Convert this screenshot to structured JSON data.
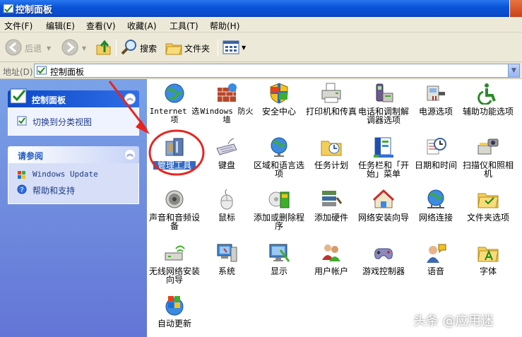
{
  "window": {
    "title": "控制面板"
  },
  "menu": [
    "文件(F)",
    "编辑(E)",
    "查看(V)",
    "收藏(A)",
    "工具(T)",
    "帮助(H)"
  ],
  "toolbar": {
    "back": "后退",
    "search": "搜索",
    "folders": "文件夹"
  },
  "address": {
    "label": "地址(D)",
    "value": "控制面板"
  },
  "left": {
    "panel1": {
      "title": "控制面板",
      "link": "切换到分类视图"
    },
    "panel2": {
      "title": "请参阅",
      "links": [
        "Windows Update",
        "帮助和支持"
      ]
    }
  },
  "items": [
    {
      "name": "Internet 选项",
      "icon": "globe-icon"
    },
    {
      "name": "Windows 防火墙",
      "icon": "firewall-icon"
    },
    {
      "name": "安全中心",
      "icon": "shield-icon"
    },
    {
      "name": "打印机和传真",
      "icon": "printer-icon"
    },
    {
      "name": "电话和调制解调器选项",
      "icon": "phone-icon"
    },
    {
      "name": "电源选项",
      "icon": "power-icon"
    },
    {
      "name": "辅助功能选项",
      "icon": "accessibility-icon"
    },
    {
      "name": "管理工具",
      "icon": "admin-tools-icon",
      "selected": true
    },
    {
      "name": "键盘",
      "icon": "keyboard-icon"
    },
    {
      "name": "区域和语言选项",
      "icon": "region-globe-icon"
    },
    {
      "name": "任务计划",
      "icon": "scheduled-folder-icon"
    },
    {
      "name": "任务栏和「开始」菜单",
      "icon": "taskbar-icon"
    },
    {
      "name": "日期和时间",
      "icon": "clock-icon"
    },
    {
      "name": "扫描仪和照相机",
      "icon": "scanner-icon"
    },
    {
      "name": "声音和音频设备",
      "icon": "speaker-icon"
    },
    {
      "name": "鼠标",
      "icon": "mouse-icon"
    },
    {
      "name": "添加或删除程序",
      "icon": "add-remove-icon"
    },
    {
      "name": "添加硬件",
      "icon": "hardware-icon"
    },
    {
      "name": "网络安装向导",
      "icon": "network-house-icon"
    },
    {
      "name": "网络连接",
      "icon": "network-globe-icon"
    },
    {
      "name": "文件夹选项",
      "icon": "folder-options-icon"
    },
    {
      "name": "无线网络安装向导",
      "icon": "wireless-icon"
    },
    {
      "name": "系统",
      "icon": "system-icon"
    },
    {
      "name": "显示",
      "icon": "display-icon"
    },
    {
      "name": "用户帐户",
      "icon": "users-icon"
    },
    {
      "name": "游戏控制器",
      "icon": "gamepad-icon"
    },
    {
      "name": "语音",
      "icon": "speech-icon"
    },
    {
      "name": "字体",
      "icon": "fonts-folder-icon"
    },
    {
      "name": "自动更新",
      "icon": "windows-update-icon"
    }
  ],
  "watermark": "头条 @应用迷",
  "colors": {
    "title_blue": "#0a55d8",
    "pane_blue": "#6d8fe0",
    "selection": "#316ac5",
    "annotation_red": "#e8241f"
  }
}
